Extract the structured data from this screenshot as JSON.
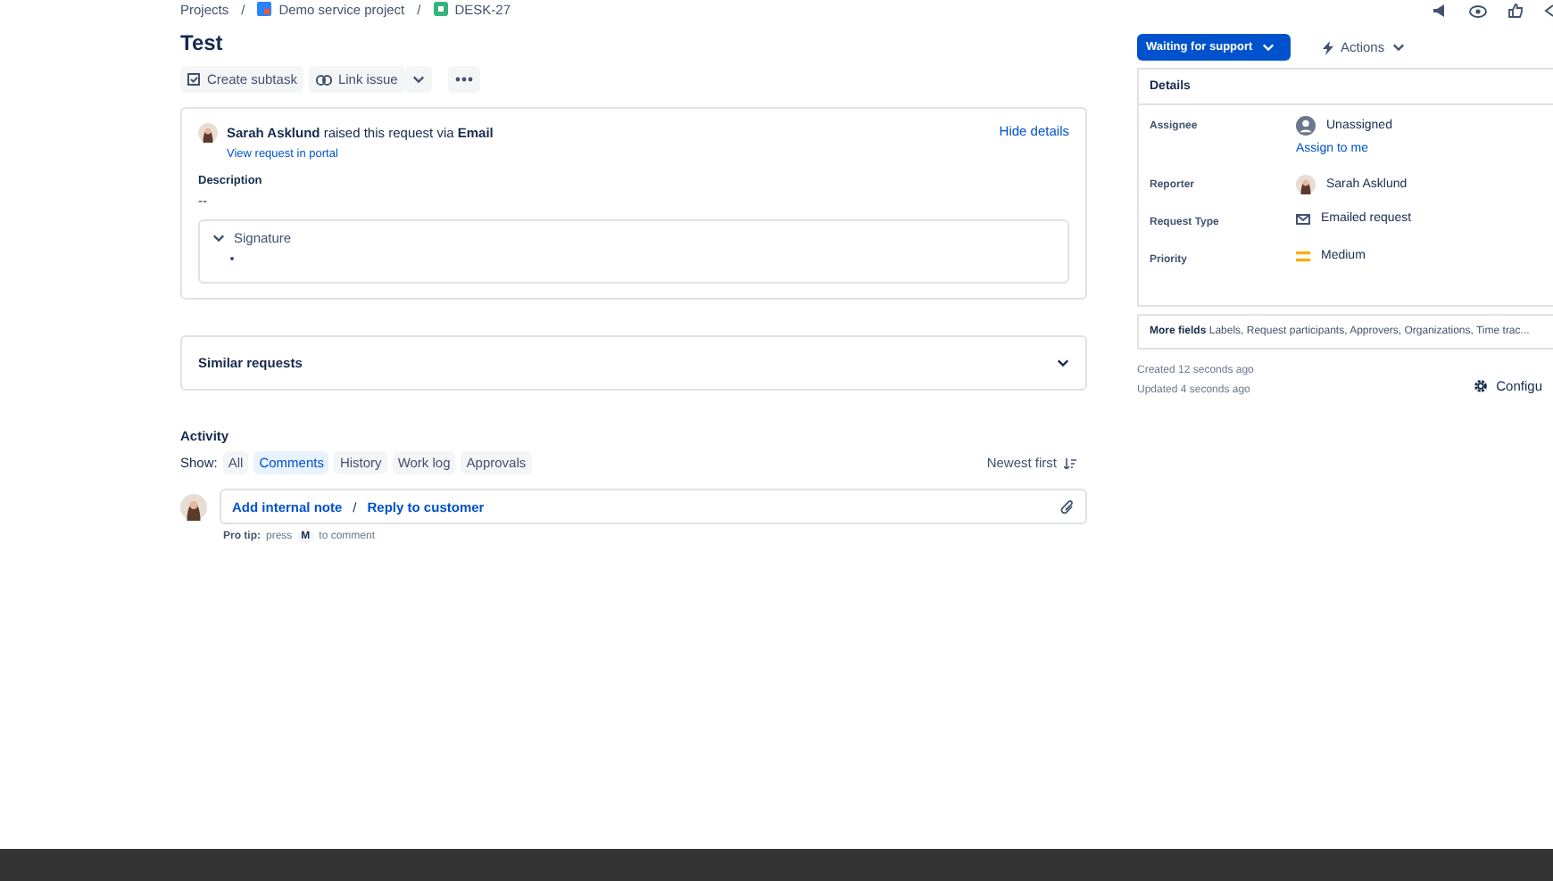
{
  "breadcrumbs": [
    {
      "label": "Projects",
      "kind": "text"
    },
    {
      "label": "Demo service project",
      "kind": "project",
      "separator": "/"
    },
    {
      "label": "DESK-27",
      "kind": "issue",
      "separator": "/"
    }
  ],
  "title": "Test",
  "toolbar": {
    "create_subtask": "Create subtask",
    "link_issue": "Link issue"
  },
  "request": {
    "reporter": "Sarah Asklund",
    "raised_text": "raised this request via",
    "channel": "Email",
    "portal_link": "View request in portal",
    "hide_details": "Hide details",
    "description_label": "Description",
    "description": "--",
    "signature": {
      "label": "Signature",
      "expanded": true
    }
  },
  "similar_requests": {
    "label": "Similar requests",
    "expanded": false
  },
  "activity": {
    "label": "Activity",
    "show_label": "Show:",
    "filters": [
      {
        "label": "All",
        "selected": false
      },
      {
        "label": "Comments",
        "selected": true
      },
      {
        "label": "History",
        "selected": false
      },
      {
        "label": "Work log",
        "selected": false
      },
      {
        "label": "Approvals",
        "selected": false
      }
    ],
    "sort": "Newest first"
  },
  "comment": {
    "add_internal_note": "Add internal note",
    "separator": "/",
    "reply": "Reply to customer",
    "pro_tip_label": "Pro tip:",
    "pro_tip_before": "press",
    "key": "M",
    "pro_tip_after": "to comment"
  },
  "status": "Waiting for support",
  "actions": "Actions",
  "details": {
    "heading": "Details",
    "fields": [
      {
        "label": "Assignee",
        "value": "Unassigned",
        "kind": "unassigned",
        "link": "Assign to me"
      },
      {
        "label": "Reporter",
        "value": "Sarah Asklund",
        "kind": "user"
      },
      {
        "label": "Request Type",
        "value": "Emailed request",
        "kind": "request_type"
      },
      {
        "label": "Priority",
        "value": "Medium",
        "kind": "priority"
      }
    ]
  },
  "more_fields": {
    "label": "More fields",
    "value": "Labels, Request participants, Approvers, Organizations, Time trac..."
  },
  "created": "Created 12 seconds ago",
  "updated": "Updated 4 seconds ago",
  "configure": "Configu"
}
